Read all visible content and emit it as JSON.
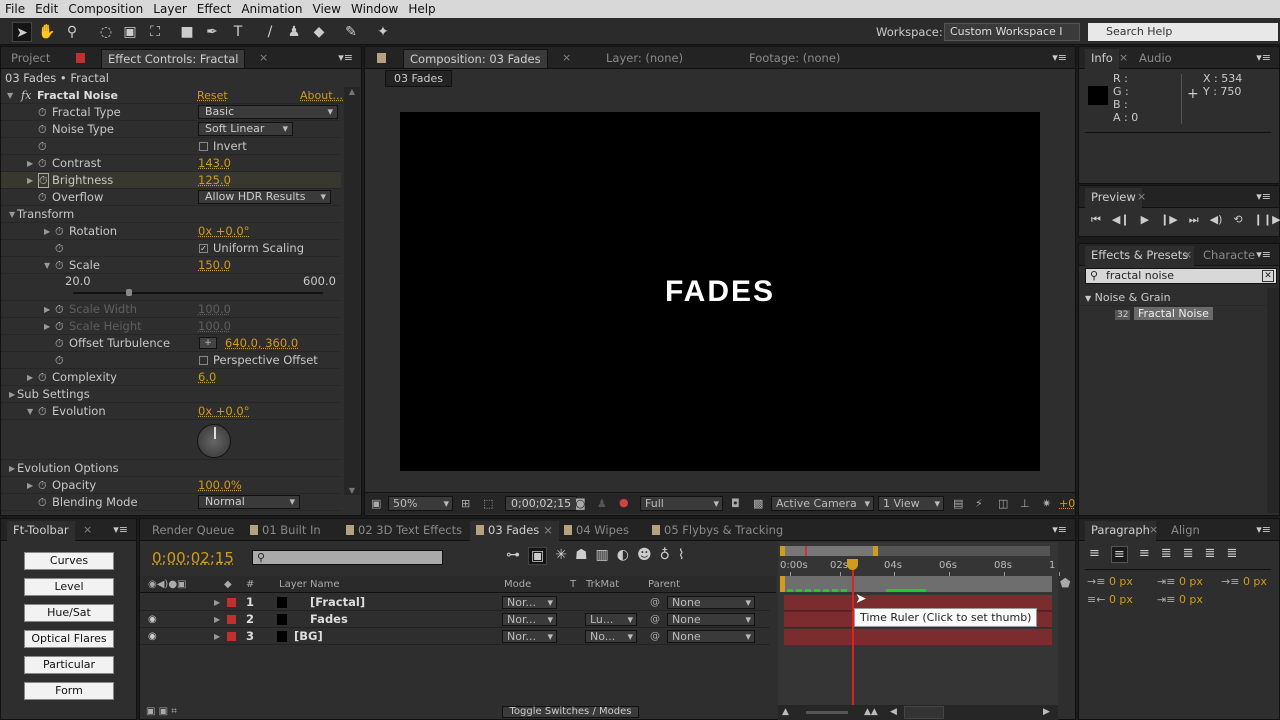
{
  "menu": [
    "File",
    "Edit",
    "Composition",
    "Layer",
    "Effect",
    "Animation",
    "View",
    "Window",
    "Help"
  ],
  "workspace": {
    "label": "Workspace:",
    "value": "Custom Workspace I"
  },
  "search_help": {
    "placeholder": "Search Help"
  },
  "left_panel": {
    "tabs": [
      "Project",
      "Effect Controls: Fractal"
    ],
    "breadcrumb": "03 Fades • Fractal",
    "effect_name": "Fractal Noise",
    "reset": "Reset",
    "about": "About...",
    "rows": [
      {
        "label": "Fractal Type",
        "lvl": 1,
        "tw": "",
        "sw": true,
        "type": "dd",
        "value": "Basic",
        "w": 140
      },
      {
        "label": "Noise Type",
        "lvl": 1,
        "tw": "",
        "sw": true,
        "type": "dd",
        "value": "Soft Linear",
        "w": 95
      },
      {
        "label": "",
        "lvl": 1,
        "tw": "",
        "sw": true,
        "type": "cb",
        "value": "Invert",
        "checked": false
      },
      {
        "label": "Contrast",
        "lvl": 1,
        "tw": "c",
        "sw": true,
        "type": "val",
        "value": "143.0"
      },
      {
        "label": "Brightness",
        "lvl": 1,
        "tw": "c",
        "sw": true,
        "type": "val",
        "value": "125.0",
        "hl": true
      },
      {
        "label": "Overflow",
        "lvl": 1,
        "tw": "",
        "sw": true,
        "type": "dd",
        "value": "Allow HDR Results",
        "w": 133
      },
      {
        "label": "Transform",
        "lvl": 0,
        "tw": "o",
        "sw": false,
        "type": "none",
        "value": ""
      },
      {
        "label": "Rotation",
        "lvl": 2,
        "tw": "c",
        "sw": true,
        "type": "val",
        "value": "0x +0.0°"
      },
      {
        "label": "",
        "lvl": 2,
        "tw": "",
        "sw": true,
        "type": "cb",
        "value": "Uniform Scaling",
        "checked": true
      },
      {
        "label": "Scale",
        "lvl": 2,
        "tw": "o",
        "sw": true,
        "type": "val",
        "value": "150.0"
      },
      {
        "label": "",
        "lvl": 2,
        "tw": "",
        "sw": false,
        "type": "slider",
        "min": "20.0",
        "max": "600.0",
        "value": 150
      },
      {
        "label": "Scale Width",
        "lvl": 2,
        "tw": "c",
        "sw": true,
        "type": "val",
        "value": "100.0",
        "dis": true
      },
      {
        "label": "Scale Height",
        "lvl": 2,
        "tw": "c",
        "sw": true,
        "type": "val",
        "value": "100.0",
        "dis": true
      },
      {
        "label": "Offset Turbulence",
        "lvl": 2,
        "tw": "",
        "sw": true,
        "type": "pt",
        "value": "640.0, 360.0"
      },
      {
        "label": "",
        "lvl": 2,
        "tw": "",
        "sw": true,
        "type": "cb",
        "value": "Perspective Offset",
        "checked": false
      },
      {
        "label": "Complexity",
        "lvl": 1,
        "tw": "c",
        "sw": true,
        "type": "val",
        "value": "6.0"
      },
      {
        "label": "Sub Settings",
        "lvl": 0,
        "tw": "c",
        "sw": false,
        "type": "none",
        "value": ""
      },
      {
        "label": "Evolution",
        "lvl": 1,
        "tw": "o",
        "sw": true,
        "type": "val",
        "value": "0x +0.0°"
      },
      {
        "label": "",
        "lvl": 1,
        "tw": "",
        "sw": false,
        "type": "dial",
        "value": ""
      },
      {
        "label": "Evolution Options",
        "lvl": 0,
        "tw": "c",
        "sw": false,
        "type": "none",
        "value": ""
      },
      {
        "label": "Opacity",
        "lvl": 1,
        "tw": "c",
        "sw": true,
        "type": "val",
        "value": "100.0%"
      },
      {
        "label": "Blending Mode",
        "lvl": 1,
        "tw": "",
        "sw": true,
        "type": "dd",
        "value": "Normal",
        "w": 102
      }
    ]
  },
  "comp": {
    "tabs": [
      "Composition: 03 Fades",
      "Layer: (none)",
      "Footage: (none)"
    ],
    "comp_button": "03 Fades",
    "viewer_text": "FADES",
    "zoom": "50%",
    "timecode": "0;00;02;15",
    "resolution": "Full",
    "camera": "Active Camera",
    "views": "1 View",
    "exposure": "+0"
  },
  "info": {
    "tabs": [
      "Info",
      "Audio"
    ],
    "r": "R :",
    "g": "G :",
    "b": "B :",
    "a": "A : 0",
    "x": "X : 534",
    "y": "Y : 750"
  },
  "preview": {
    "tab": "Preview"
  },
  "effects_presets": {
    "tabs": [
      "Effects & Presets",
      "Characte"
    ],
    "search": "fractal noise",
    "category": "Noise & Grain",
    "item": "Fractal Noise"
  },
  "ft_toolbar": {
    "tab": "Ft-Toolbar",
    "buttons": [
      "Curves",
      "Level",
      "Hue/Sat",
      "Optical Flares",
      "Particular",
      "Form"
    ]
  },
  "timeline": {
    "tabs": [
      "Render Queue",
      "01 Built In",
      "02 3D Text Effects",
      "03 Fades",
      "04 Wipes",
      "05 Flybys & Tracking"
    ],
    "timecode": "0;00;02;15",
    "columns": {
      "num": "#",
      "name": "Layer Name",
      "mode": "Mode",
      "t": "T",
      "trkmat": "TrkMat",
      "parent": "Parent"
    },
    "layers": [
      {
        "num": "1",
        "name": "[Fractal]",
        "mode": "Nor...",
        "trkmat": "",
        "parent": "None",
        "visible": false
      },
      {
        "num": "2",
        "name": "Fades",
        "mode": "Nor...",
        "trkmat": "Lu...",
        "parent": "None",
        "visible": true
      },
      {
        "num": "3",
        "name": "[BG]",
        "mode": "Nor...",
        "trkmat": "No...",
        "parent": "None",
        "visible": true
      }
    ],
    "ruler": [
      "0:00s",
      "02s",
      "04s",
      "06s",
      "08s",
      "1"
    ],
    "tooltip": "Time Ruler (Click to set thumb)",
    "toggle": "Toggle Switches / Modes",
    "accent": "#d19b1d",
    "layer_color": "#c03030",
    "bar_color": "#7a2c2f"
  },
  "paragraph": {
    "tabs": [
      "Paragraph",
      "Align"
    ],
    "fields": [
      "0 px",
      "0 px",
      "0 px",
      "0 px",
      "0 px"
    ]
  }
}
